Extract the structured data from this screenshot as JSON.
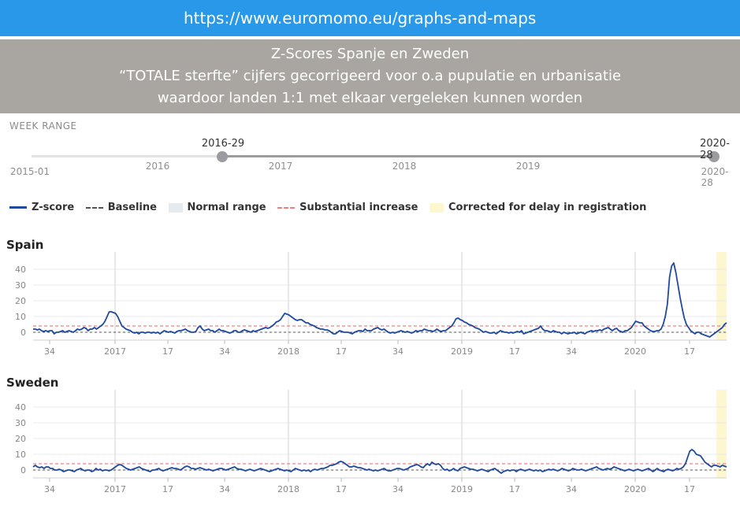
{
  "url": "https://www.euromomo.eu/graphs-and-maps",
  "banner": {
    "line1": "Z-Scores Spanje en Zweden",
    "line2": "“TOTALE sterfte” cijfers gecorrigeerd voor o.a pupulatie en urbanisatie",
    "line3": "waardoor landen 1:1 met elkaar vergeleken kunnen worden"
  },
  "week_range": {
    "label": "WEEK RANGE",
    "start_label": "2016-29",
    "end_label": "2020-28",
    "min_label": "2015-01",
    "max_label": "2020-28",
    "years": [
      "2016",
      "2017",
      "2018",
      "2019"
    ]
  },
  "legend": {
    "zscore": "Z-score",
    "baseline": "Baseline",
    "normal_range": "Normal range",
    "substantial": "Substantial increase",
    "corrected": "Corrected for delay in registration"
  },
  "colors": {
    "zscore": "#1f4aa0",
    "baseline": "#555555",
    "normal_range": "#e6ebf0",
    "substantial": "#f08080",
    "corrected": "#fdf7cf"
  },
  "chart_data": [
    {
      "type": "line",
      "title": "Spain",
      "ylim": [
        -5,
        45
      ],
      "yticks": [
        0,
        10,
        20,
        30,
        40
      ],
      "xticks": [
        "34",
        "2017",
        "17",
        "34",
        "2018",
        "17",
        "34",
        "2019",
        "17",
        "34",
        "2020",
        "17"
      ],
      "baseline": 0,
      "substantial_increase": 4,
      "series": [
        {
          "name": "Z-score",
          "x_start": "2016-29",
          "values": [
            2,
            2,
            1.5,
            2,
            1,
            0.5,
            1,
            0.5,
            1,
            1,
            -1,
            0,
            0,
            0.5,
            1,
            0,
            0.5,
            1,
            0.5,
            0,
            1,
            2,
            1.5,
            2,
            3,
            2.5,
            1,
            2,
            2,
            3,
            2,
            3,
            4,
            5,
            7,
            10,
            13,
            13,
            12.5,
            12,
            10,
            7,
            4,
            3,
            2,
            1.5,
            1,
            0,
            -0.5,
            0,
            -1,
            0,
            0,
            -0.5,
            0,
            0,
            -0.5,
            0,
            -0.5,
            0,
            -1,
            0,
            1,
            0.5,
            0,
            0.5,
            0,
            -0.5,
            0.5,
            1,
            1,
            1.5,
            2,
            1,
            0.5,
            0,
            0,
            0.5,
            3,
            4,
            2,
            1,
            1.5,
            2,
            1,
            1,
            0,
            1,
            2,
            1,
            1,
            0.5,
            0,
            -0.5,
            0,
            1,
            1,
            0,
            0,
            1,
            1.5,
            1,
            0.5,
            0,
            1,
            0.5,
            1,
            1.5,
            2,
            2.5,
            3,
            2.5,
            3,
            4,
            5,
            6.5,
            7,
            8,
            10,
            12,
            11.5,
            11,
            10,
            9,
            8,
            7.5,
            8,
            8,
            7,
            6,
            6,
            5,
            4.5,
            4,
            3,
            2.5,
            2,
            2,
            1.5,
            1.5,
            1,
            0,
            -1,
            -1,
            0,
            1,
            0.5,
            0,
            0,
            0,
            -0.5,
            -1,
            0,
            0.5,
            1,
            1,
            0.5,
            2,
            1,
            1,
            1,
            2,
            2.5,
            3,
            2,
            1.5,
            2,
            1,
            0,
            -0.5,
            0,
            -0.5,
            0,
            0.5,
            1,
            0.5,
            0,
            0.5,
            0,
            -0.5,
            0,
            1,
            0.5,
            1,
            1,
            2,
            1.5,
            1,
            1,
            0.5,
            1,
            2,
            1,
            0.5,
            1,
            1,
            2,
            3,
            4,
            6,
            8.5,
            9,
            8,
            7.5,
            6.5,
            6,
            5,
            4.5,
            4,
            3,
            2.5,
            2,
            1,
            0,
            0.5,
            0,
            -0.5,
            -0.5,
            0,
            -1,
            0,
            1,
            0.5,
            0,
            0,
            -0.5,
            0,
            -0.5,
            0,
            0.5,
            0,
            1,
            -1,
            -0.5,
            0,
            0.5,
            1,
            1.5,
            2,
            2.5,
            4,
            2,
            1,
            1,
            0.5,
            0,
            1,
            0.5,
            0,
            0,
            -1,
            0,
            -0.5,
            -1,
            -0.5,
            -0.5,
            0,
            -1,
            -0.5,
            0,
            -0.5,
            -1,
            0,
            0.5,
            1,
            0.5,
            1,
            1,
            1.5,
            1,
            2,
            2.5,
            3,
            2,
            1,
            2,
            2.5,
            1,
            0.5,
            0,
            1,
            1,
            2,
            3,
            5,
            7,
            6.5,
            6,
            6,
            4,
            3,
            2,
            1,
            0.5,
            0.5,
            1,
            1,
            2,
            5,
            10,
            18,
            35,
            42,
            44,
            38,
            30,
            22,
            15,
            9,
            5,
            3,
            1,
            0,
            -1,
            0,
            0,
            -1,
            -1.5,
            -2,
            -2.5,
            -3,
            -2,
            -1,
            0,
            1,
            2,
            3,
            5,
            6
          ]
        }
      ]
    },
    {
      "type": "line",
      "title": "Sweden",
      "ylim": [
        -5,
        45
      ],
      "yticks": [
        0,
        10,
        20,
        30,
        40
      ],
      "xticks": [
        "34",
        "2017",
        "17",
        "34",
        "2018",
        "17",
        "34",
        "2019",
        "17",
        "34",
        "2020",
        "17"
      ],
      "baseline": 0,
      "substantial_increase": 4,
      "series": [
        {
          "name": "Z-score",
          "x_start": "2016-29",
          "values": [
            2,
            3,
            2,
            1.5,
            2,
            1,
            2,
            2,
            1,
            1,
            0,
            0,
            0.5,
            0,
            -1,
            -0.5,
            0,
            0,
            -0.5,
            -1,
            0,
            0.5,
            1,
            0,
            -0.5,
            0,
            0,
            -1,
            -0.5,
            1,
            0,
            0.5,
            -0.5,
            0,
            0,
            -0.5,
            0,
            1,
            2,
            3,
            3.5,
            3,
            2,
            1,
            0.5,
            0,
            0.5,
            1,
            1.5,
            2,
            1,
            0.5,
            0,
            -0.5,
            -1,
            0,
            0,
            0.5,
            1,
            0,
            -0.5,
            0,
            0.5,
            1,
            1.5,
            1,
            1,
            0.5,
            0,
            1,
            2,
            2.5,
            2,
            1,
            1,
            0.5,
            1,
            1.5,
            1,
            0.5,
            0,
            0.5,
            0,
            -0.5,
            0,
            0.5,
            1,
            1,
            0.5,
            0,
            0.5,
            1,
            1.5,
            2,
            1,
            0.5,
            0.5,
            0,
            -0.5,
            0,
            0.5,
            0,
            -0.5,
            0,
            0.5,
            1,
            0.5,
            0,
            -0.5,
            -1,
            -0.5,
            0,
            0.5,
            1,
            0.5,
            0,
            -0.5,
            0,
            -0.5,
            -1,
            0,
            1,
            0.5,
            0,
            -0.5,
            0,
            -0.5,
            0,
            -1,
            0,
            0.5,
            0,
            0.5,
            1,
            1,
            1.5,
            2,
            3,
            3,
            3.5,
            4,
            5,
            5.5,
            5,
            4,
            3,
            2,
            2,
            2.5,
            2,
            1.5,
            1.5,
            1,
            0.5,
            0,
            0.5,
            0,
            -0.5,
            0,
            -0.5,
            0,
            0.5,
            1,
            0,
            -0.5,
            -0.5,
            0,
            0.5,
            1,
            1,
            0.5,
            0,
            0.5,
            1,
            2,
            2.5,
            3,
            3.5,
            3,
            2,
            1.5,
            3,
            4,
            3,
            5,
            4,
            3.5,
            4,
            3,
            1,
            0,
            0.5,
            -0.5,
            0,
            1,
            0,
            -0.5,
            1,
            1.5,
            2,
            1.5,
            1,
            0.5,
            0.5,
            0,
            -0.5,
            0,
            0.5,
            0,
            -0.5,
            -1,
            0,
            0.5,
            1,
            0,
            -1,
            -2,
            -1,
            -0.5,
            0,
            -0.5,
            0,
            0,
            -1,
            0,
            0.5,
            0,
            -0.5,
            0,
            0.5,
            0,
            -0.5,
            0,
            -0.5,
            0,
            -1,
            -0.5,
            0,
            0.5,
            0,
            0.5,
            0,
            -0.5,
            0,
            1,
            0.5,
            0,
            -0.5,
            0,
            1,
            0.5,
            0,
            0,
            0.5,
            0,
            -0.5,
            0,
            0.5,
            1,
            1.5,
            2,
            1,
            0.5,
            0,
            0.5,
            1,
            0.5,
            1,
            2,
            1.5,
            1,
            0.5,
            0,
            -0.5,
            0,
            0.5,
            0,
            -0.5,
            0,
            0.5,
            0,
            -0.5,
            0,
            0.5,
            1,
            0,
            -1,
            0,
            1,
            0,
            -0.5,
            -1,
            0,
            0.5,
            0,
            -0.5,
            0,
            1,
            0.5,
            1,
            2,
            4,
            8,
            12,
            13,
            12,
            10,
            9.5,
            9,
            7,
            5,
            4,
            3,
            2,
            3,
            3,
            2.5,
            2,
            3,
            2.5,
            2
          ]
        }
      ]
    }
  ]
}
